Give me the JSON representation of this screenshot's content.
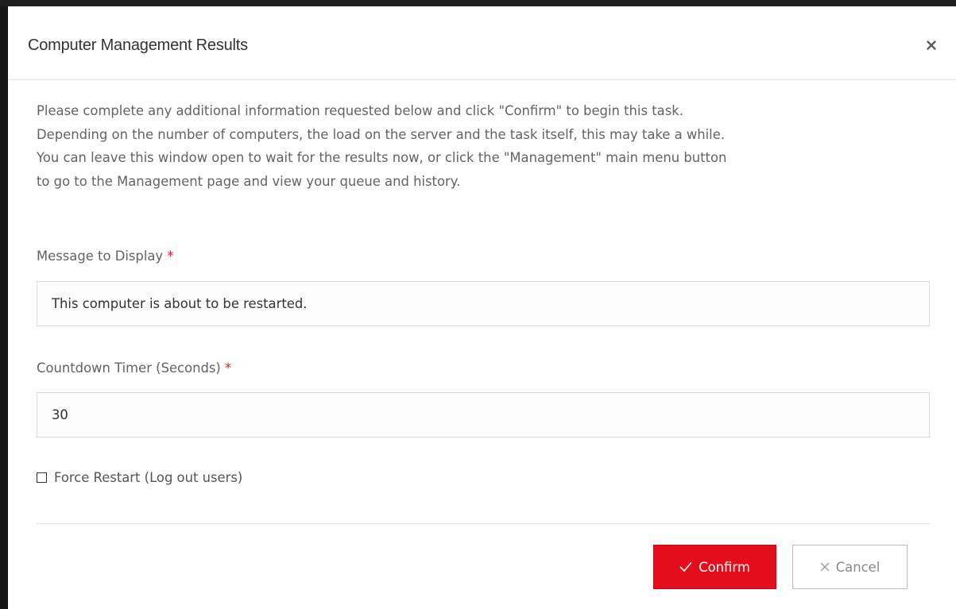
{
  "modal": {
    "title": "Computer Management Results",
    "close_label": "×",
    "intro_lines": [
      "Please complete any additional information requested below and click \"Confirm\" to begin this task.",
      "Depending on the number of computers, the load on the server and the task itself, this may take a while.",
      "You can leave this window open to wait for the results now, or click the \"Management\" main menu button",
      "to go to the Management page and view your queue and history."
    ]
  },
  "form": {
    "message": {
      "label": "Message to Display",
      "required_mark": "*",
      "value": "This computer is about to be restarted."
    },
    "countdown": {
      "label": "Countdown Timer (Seconds)",
      "required_mark": "*",
      "value": "30"
    },
    "force_restart": {
      "label": "Force Restart (Log out users)",
      "checked": false
    }
  },
  "footer": {
    "confirm_label": "Confirm",
    "cancel_label": "Cancel"
  },
  "colors": {
    "accent": "#e30d1b",
    "required": "#d11f1f",
    "text": "#636363",
    "backdrop": "#151515"
  },
  "icons": {
    "close": "close-icon",
    "confirm": "check-icon",
    "cancel": "x-icon",
    "checkbox": "checkbox-unchecked"
  }
}
